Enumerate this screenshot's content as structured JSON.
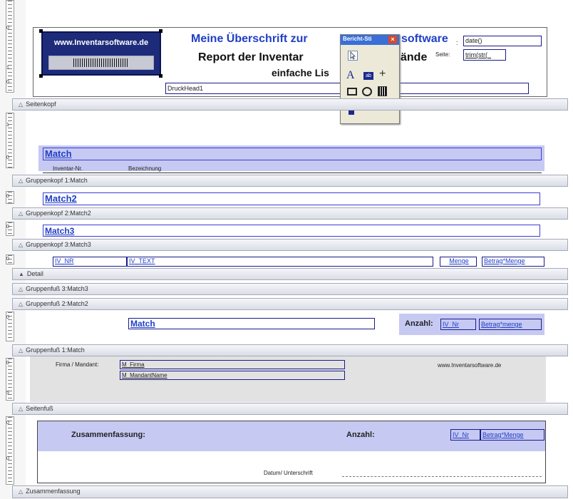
{
  "ruler": {
    "marks": [
      "0",
      "1",
      "0",
      "1",
      "0",
      "0",
      "0",
      "0",
      "0",
      "0",
      "0",
      "5",
      "0",
      "0",
      "0"
    ]
  },
  "page_header": {
    "logo_text": "www.Inventarsoftware.de",
    "title_line1": "Meine Überschrift zur ",
    "title_line1_end": "software",
    "title_line2": "Report der Inventar",
    "title_line2_end": "ände",
    "title_line3": "einfache Lis",
    "date_label": ":",
    "date_field": "date()",
    "page_label": "Seite:",
    "page_field": "trim(str(_",
    "druck_head": "DruckHead1"
  },
  "toolbox": {
    "title": "Bericht-Sti",
    "close": "×",
    "tools": [
      "pointer-icon",
      "text-icon",
      "image-icon",
      "line-icon",
      "rectangle-icon",
      "ellipse-icon",
      "barcode-icon",
      "lock-icon"
    ],
    "text_glyph": "A",
    "line_glyph": "+",
    "image_glyph": "ab"
  },
  "bands": {
    "seitenkopf": "Seitenkopf",
    "gk1": "Gruppenkopf 1:Match",
    "gk2": "Gruppenkopf 2:Match2",
    "gk3": "Gruppenkopf 3:Match3",
    "detail": "Detail",
    "gf3": "Gruppenfuß 3:Match3",
    "gf2": "Gruppenfuß 2:Match2",
    "gf1": "Gruppenfuß 1:Match",
    "seitenfuss": "Seitenfuß",
    "zusammenfassung": "Zusammenfassung"
  },
  "group1": {
    "match": "Match",
    "col_inventar": "Inventar-Nr.",
    "col_bezeichnung": "Bezeichnung"
  },
  "group2": {
    "match": "Match2"
  },
  "group3": {
    "match": "Match3"
  },
  "detail": {
    "iv_nr": "IV_NR",
    "iv_text": "IV_TEXT",
    "menge": "Menge",
    "betrag": "Betrag*Menge"
  },
  "footer2": {
    "match": "Match",
    "anzahl_label": "Anzahl:",
    "iv_nr": "IV_Nr",
    "betrag": "Betrag*menge"
  },
  "page_footer": {
    "firma_label": "Firma / Mandant:",
    "m_firma": "M_Firma",
    "m_mandant": "M_MandantName",
    "website": "www.Inventarsoftware.de"
  },
  "summary": {
    "title": "Zusammenfassung:",
    "anzahl_label": "Anzahl:",
    "iv_nr": "IV_Nr",
    "betrag": "Betrag*Menge",
    "datum_label": "Datum/ Unterschrift"
  }
}
